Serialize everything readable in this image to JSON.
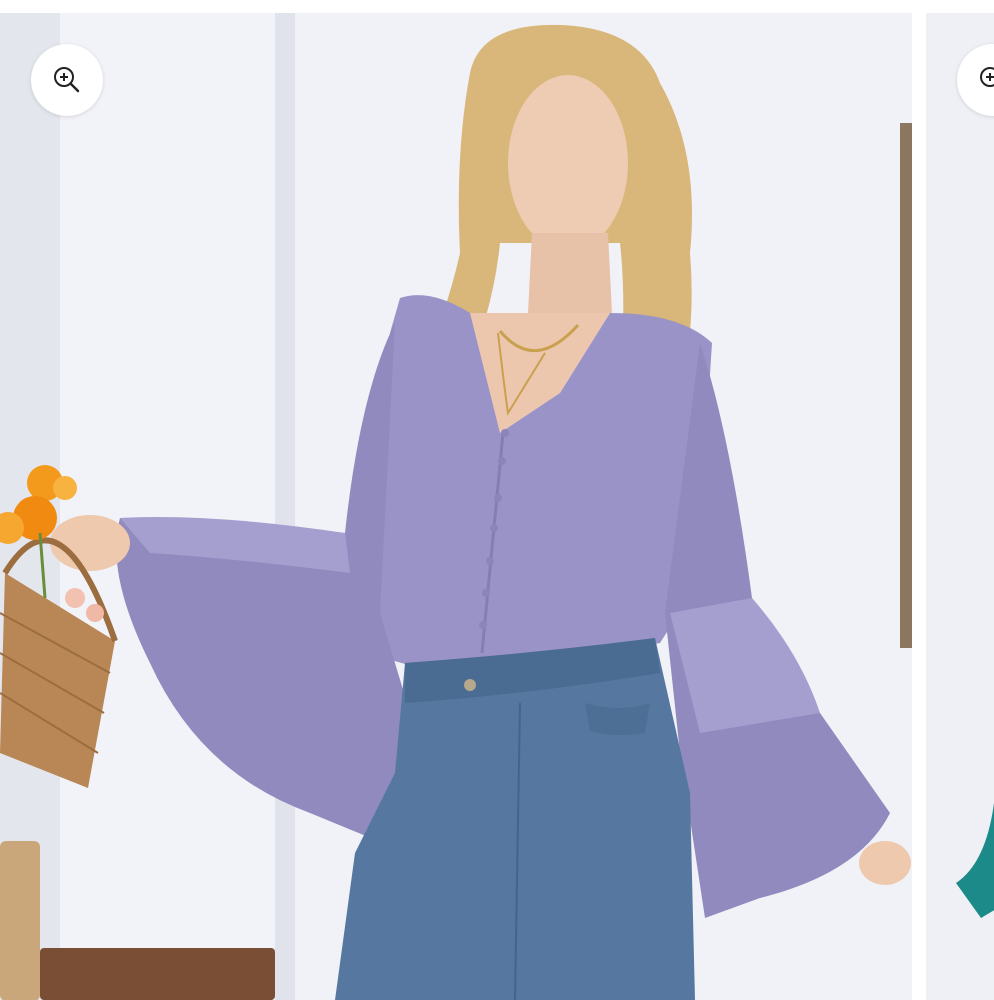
{
  "gallery": {
    "current_image": {
      "subject": "model-wearing-lavender-bell-sleeve-blouse-and-blue-jeans",
      "zoom_icon": "zoom-in-icon"
    },
    "next_image": {
      "subject": "teal-bell-sleeve-blouse-partial",
      "zoom_icon": "zoom-in-icon"
    }
  },
  "colors": {
    "page_background": "#ffffff",
    "wall": "#eceef4",
    "blouse": "#9a93c7",
    "jeans": "#5678a0",
    "basket": "#b88755",
    "flowers": "#f39a1c",
    "teal_garment": "#1d8a8a"
  }
}
